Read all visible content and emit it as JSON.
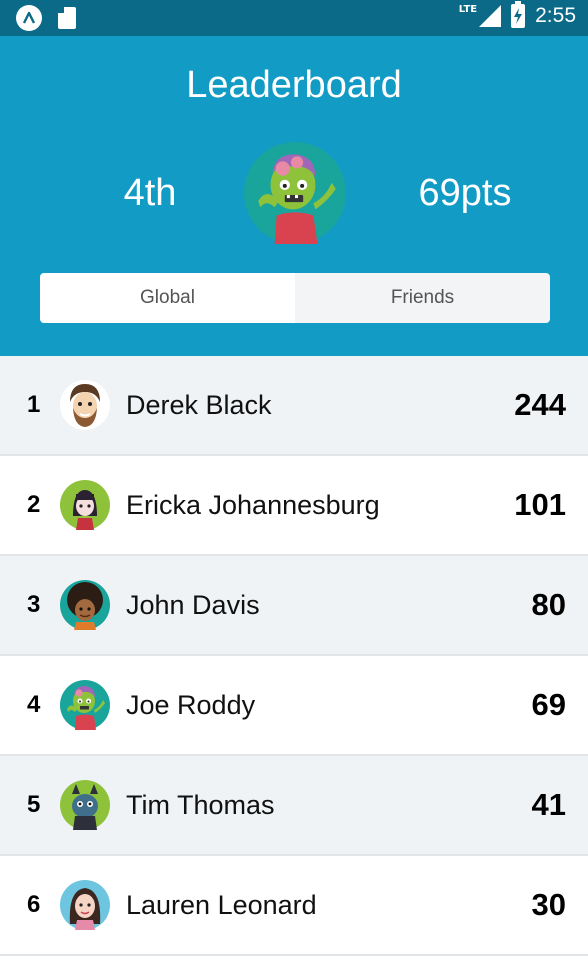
{
  "status_bar": {
    "network": "LTE",
    "time": "2:55"
  },
  "header": {
    "title": "Leaderboard",
    "rank": "4th",
    "points": "69pts"
  },
  "tabs": [
    {
      "label": "Global",
      "active": true
    },
    {
      "label": "Friends",
      "active": false
    }
  ],
  "leaderboard": [
    {
      "position": "1",
      "name": "Derek Black",
      "score": "244",
      "avatar": "bearded-man-avatar"
    },
    {
      "position": "2",
      "name": "Ericka Johannesburg",
      "score": "101",
      "avatar": "girl-avatar"
    },
    {
      "position": "3",
      "name": "John Davis",
      "score": "80",
      "avatar": "afro-avatar"
    },
    {
      "position": "4",
      "name": "Joe Roddy",
      "score": "69",
      "avatar": "zombie-avatar"
    },
    {
      "position": "5",
      "name": "Tim Thomas",
      "score": "41",
      "avatar": "monster-avatar"
    },
    {
      "position": "6",
      "name": "Lauren Leonard",
      "score": "30",
      "avatar": "woman-avatar"
    }
  ],
  "colors": {
    "header_bg": "#129bc4",
    "status_bg": "#0a6a88",
    "row_alt_bg": "#f0f3f5"
  }
}
